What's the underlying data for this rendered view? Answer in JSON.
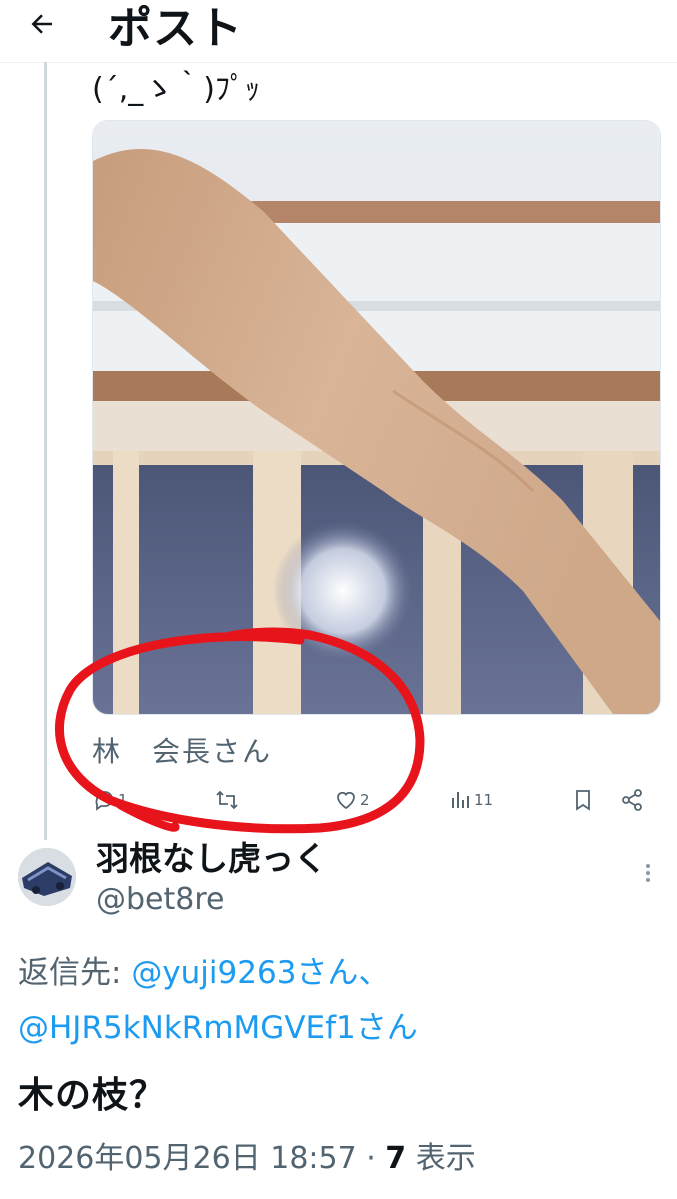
{
  "header": {
    "title": "ポスト"
  },
  "parent_post": {
    "text": "(´,_ゝ｀)ﾌﾟｯ",
    "image_caption": "林　会長さん",
    "actions": {
      "reply_count": "1",
      "like_count": "2",
      "view_count": "11"
    }
  },
  "reply_post": {
    "display_name": "羽根なし虎っく",
    "handle": "@bet8re",
    "reply_to_label": "返信先: ",
    "reply_to_user1": "@yuji9263さん",
    "reply_to_sep": "、",
    "reply_to_user2": "@HJR5kNkRmMGVEf1さん",
    "text": "木の枝？",
    "timestamp": "2026年05月26日 18:57",
    "dot": " · ",
    "view_count": "7",
    "view_label": " 表示"
  },
  "colors": {
    "accent": "#1d9bf0",
    "secondary_text": "#536471",
    "annotation_red": "#e8141b"
  }
}
